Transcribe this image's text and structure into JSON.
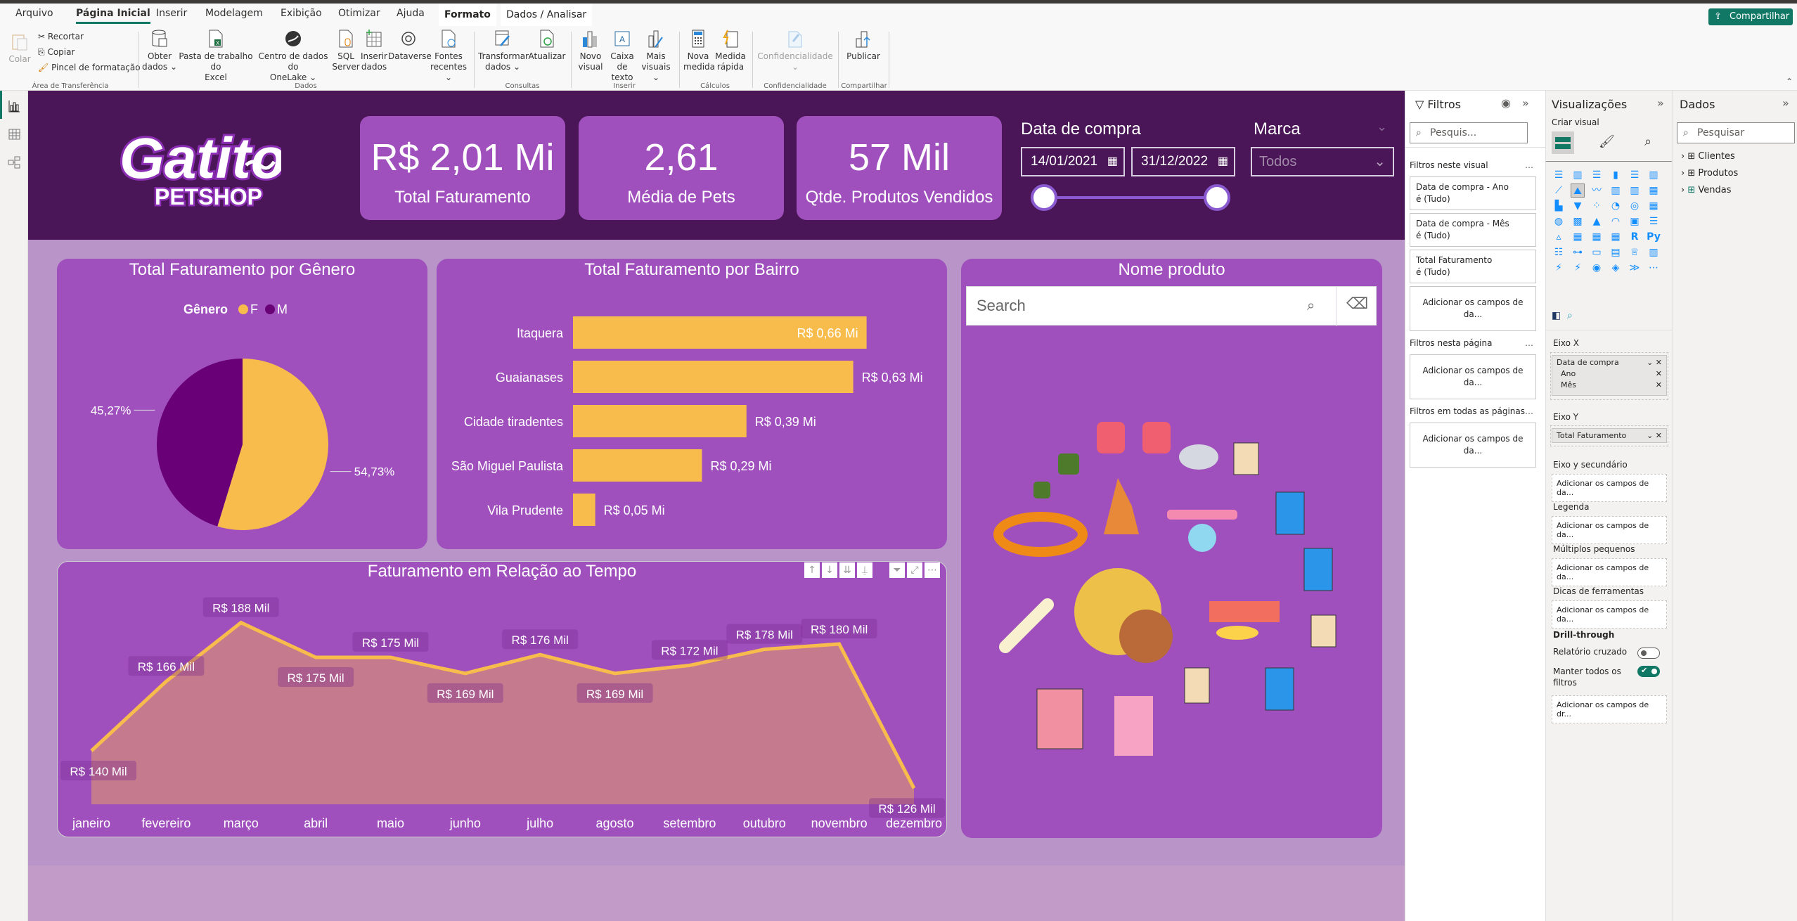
{
  "ribbon": {
    "tabs": [
      "Arquivo",
      "Página Inicial",
      "Inserir",
      "Modelagem",
      "Exibição",
      "Otimizar",
      "Ajuda",
      "Formato",
      "Dados / Analisar"
    ],
    "active_tab": "Página Inicial",
    "share_label": "Compartilhar",
    "clipboard": {
      "paste": "Colar",
      "cut": "Recortar",
      "copy": "Copiar",
      "format_painter": "Pincel de formatação",
      "group": "Área de Transferência"
    },
    "data_group": {
      "items": [
        {
          "l1": "Obter",
          "l2": "dados ⌄",
          "icon": "database-icon"
        },
        {
          "l1": "Pasta de trabalho do",
          "l2": "Excel",
          "icon": "excel-icon"
        },
        {
          "l1": "Centro de dados do",
          "l2": "OneLake ⌄",
          "icon": "onelake-icon"
        },
        {
          "l1": "SQL",
          "l2": "Server",
          "icon": "sql-server-icon"
        },
        {
          "l1": "Inserir",
          "l2": "dados",
          "icon": "insert-data-icon"
        },
        {
          "l1": "Dataverse",
          "l2": "",
          "icon": "dataverse-icon"
        },
        {
          "l1": "Fontes",
          "l2": "recentes ⌄",
          "icon": "recent-sources-icon"
        }
      ],
      "group": "Dados"
    },
    "queries_group": {
      "items": [
        {
          "l1": "Transformar",
          "l2": "dados ⌄"
        },
        {
          "l1": "Atualizar",
          "l2": ""
        }
      ],
      "group": "Consultas"
    },
    "insert_group": {
      "items": [
        {
          "l1": "Novo",
          "l2": "visual"
        },
        {
          "l1": "Caixa de",
          "l2": "texto"
        },
        {
          "l1": "Mais",
          "l2": "visuais ⌄"
        }
      ],
      "group": "Inserir"
    },
    "calc_group": {
      "items": [
        {
          "l1": "Nova",
          "l2": "medida"
        },
        {
          "l1": "Medida",
          "l2": "rápida"
        }
      ],
      "group": "Cálculos"
    },
    "sensitivity_group": {
      "items": [
        {
          "l1": "Confidencialidade",
          "l2": "⌄"
        }
      ],
      "group": "Confidencialidade"
    },
    "share_group": {
      "items": [
        {
          "l1": "Publicar",
          "l2": ""
        }
      ],
      "group": "Compartilhar"
    }
  },
  "report": {
    "logo": {
      "line1": "Gatito",
      "line2": "PETSHOP"
    },
    "kpis": [
      {
        "value": "R$ 2,01 Mi",
        "label": "Total Faturamento"
      },
      {
        "value": "2,61",
        "label": "Média de Pets"
      },
      {
        "value": "57 Mil",
        "label": "Qtde. Produtos Vendidos"
      }
    ],
    "date_slicer": {
      "title": "Data de compra",
      "start": "14/01/2021",
      "end": "31/12/2022",
      "range_fraction": [
        0,
        1
      ]
    },
    "brand_slicer": {
      "title": "Marca",
      "value": "Todos"
    },
    "product_slicer": {
      "title": "Nome produto",
      "placeholder": "Search"
    },
    "colors": {
      "header": "#4a1657",
      "body": "#b994c9",
      "card": "#a050bd",
      "accent": "#f8bc4c",
      "dark_purple": "#690077"
    }
  },
  "chart_data": [
    {
      "type": "pie",
      "title": "Total Faturamento por Gênero",
      "legend_title": "Gênero",
      "legend_position": "top",
      "categories": [
        "F",
        "M"
      ],
      "values": [
        54.73,
        45.27
      ],
      "labels": [
        "54,73%",
        "45,27%"
      ],
      "colors": [
        "#f8bc4c",
        "#690077"
      ]
    },
    {
      "type": "bar",
      "orientation": "horizontal",
      "title": "Total Faturamento por Bairro",
      "categories": [
        "Itaquera",
        "Guaianases",
        "Cidade tiradentes",
        "São Miguel Paulista",
        "Vila Prudente"
      ],
      "values": [
        0.66,
        0.63,
        0.39,
        0.29,
        0.05
      ],
      "labels": [
        "R$ 0,66 Mi",
        "R$ 0,63 Mi",
        "R$ 0,39 Mi",
        "R$ 0,29 Mi",
        "R$ 0,05 Mi"
      ],
      "unit": "R$ Mi",
      "color": "#f8bc4c"
    },
    {
      "type": "area",
      "title": "Faturamento em Relação ao Tempo",
      "categories": [
        "janeiro",
        "fevereiro",
        "março",
        "abril",
        "maio",
        "junho",
        "julho",
        "agosto",
        "setembro",
        "outubro",
        "novembro",
        "dezembro"
      ],
      "values": [
        140,
        166,
        188,
        175,
        175,
        169,
        176,
        169,
        172,
        178,
        180,
        126
      ],
      "labels": [
        "R$ 140 Mil",
        "R$ 166 Mil",
        "R$ 188 Mil",
        "R$ 175 Mil",
        "R$ 175 Mil",
        "R$ 169 Mil",
        "R$ 176 Mil",
        "R$ 169 Mil",
        "R$ 172 Mil",
        "R$ 178 Mil",
        "R$ 180 Mil",
        "R$ 126 Mil"
      ],
      "label_side": [
        "below",
        "above",
        "above",
        "below",
        "above",
        "below",
        "above",
        "below",
        "above",
        "above",
        "above",
        "below"
      ],
      "unit": "R$ Mil",
      "ylim": [
        120,
        195
      ],
      "line_color": "#f8bc4c",
      "fill_color": "#c57a8e"
    }
  ],
  "filters_pane": {
    "title": "Filtros",
    "search_placeholder": "Pesquis...",
    "this_visual_label": "Filtros neste visual",
    "this_visual": [
      {
        "l1": "Data de compra - Ano",
        "l2": "é (Tudo)"
      },
      {
        "l1": "Data de compra - Mês",
        "l2": "é (Tudo)"
      },
      {
        "l1": "Total Faturamento",
        "l2": "é (Tudo)"
      }
    ],
    "add_fields": "Adicionar os campos de da...",
    "this_page_label": "Filtros nesta página",
    "all_pages_label": "Filtros em todas as páginas"
  },
  "viz_pane": {
    "title": "Visualizações",
    "build_label": "Criar visual",
    "x_axis_label": "Eixo X",
    "x_axis_field": "Data de compra",
    "x_axis_sub": [
      "Ano",
      "Mês"
    ],
    "y_axis_label": "Eixo Y",
    "y_axis_field": "Total Faturamento",
    "wells": [
      "Eixo y secundário",
      "Legenda",
      "Múltiplos pequenos",
      "Dicas de ferramentas"
    ],
    "well_placeholder": "Adicionar os campos de da...",
    "drill_title": "Drill-through",
    "cross_report": "Relatório cruzado",
    "cross_report_on": false,
    "keep_filters": "Manter todos os filtros",
    "keep_filters_on": true,
    "drill_placeholder": "Adicionar os campos de dr..."
  },
  "data_pane": {
    "title": "Dados",
    "search_placeholder": "Pesquisar",
    "tables": [
      "Clientes",
      "Produtos",
      "Vendas"
    ]
  }
}
